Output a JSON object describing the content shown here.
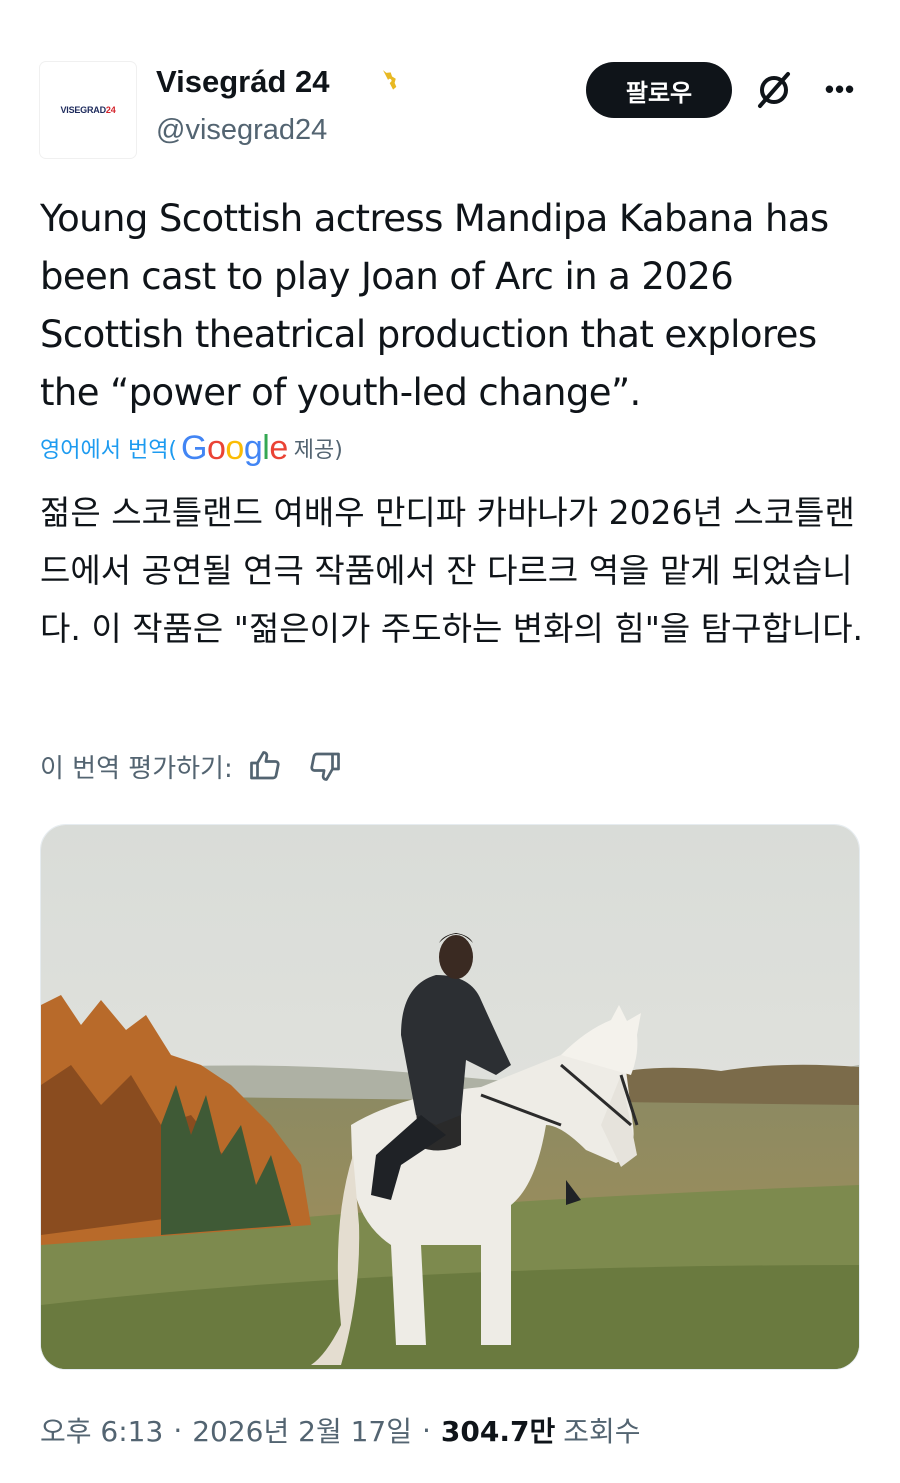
{
  "author": {
    "display_name": "Visegrád 24",
    "handle": "@visegrad24",
    "avatar_text": "VISEGRAD",
    "avatar_text_accent": "24",
    "verified_icon": "gold-verified-badge-icon"
  },
  "actions": {
    "follow_label": "팔로우",
    "grok_icon": "grok-icon",
    "more_icon": "more-options-icon"
  },
  "tweet": {
    "text": "Young Scottish actress Mandipa Kabana has been cast to play Joan of Arc in a 2026 Scottish theatrical production that explores the “power of youth-led change”.",
    "translate_link": "영어에서 번역(",
    "translate_provider": "Google",
    "translate_provided": "제공)",
    "translated_text": "젊은 스코틀랜드 여배우 만디파 카바나가 2026년 스코틀랜드에서 공연될 연극 작품에서 잔 다르크 역을 맡게 되었습니다. 이 작품은 \"젊은이가 주도하는 변화의 힘\"을 탐구합니다.",
    "rate_label": "이 번역 평가하기:",
    "thumbs_up_icon": "thumbs-up-icon",
    "thumbs_down_icon": "thumbs-down-icon"
  },
  "media": {
    "type": "photo",
    "alt": ""
  },
  "meta": {
    "time": "오후 6:13",
    "separator": "·",
    "date": "2026년 2월 17일",
    "views_count": "304.7만",
    "views_label": "조회수"
  },
  "colors": {
    "text": "#0f1419",
    "secondary": "#536471",
    "link": "#1d9bf0",
    "follow_bg": "#0f1419",
    "verified_gold": "#e8b923"
  }
}
